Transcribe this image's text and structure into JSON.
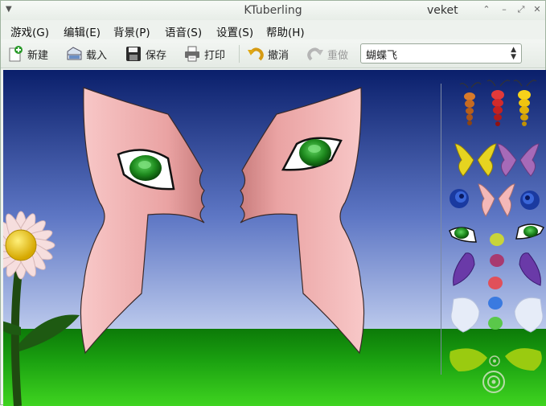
{
  "window": {
    "title": "KTuberling",
    "user": "veket",
    "buttons": {
      "minimize": "⌃",
      "maximize": "–",
      "restore": "⤢",
      "close": "✕"
    }
  },
  "menu": [
    {
      "label": "游戏(G)"
    },
    {
      "label": "编辑(E)"
    },
    {
      "label": "背景(P)"
    },
    {
      "label": "语音(S)"
    },
    {
      "label": "设置(S)"
    },
    {
      "label": "帮助(H)"
    }
  ],
  "toolbar": {
    "new_label": "新建",
    "load_label": "载入",
    "save_label": "保存",
    "print_label": "打印",
    "undo_label": "撤消",
    "redo_label": "重做"
  },
  "playground_select": {
    "value": "蝴蝶飞"
  },
  "colors": {
    "sky_top": "#0a1f6b",
    "sky_bottom": "#b8c6ee",
    "grass": "#1a9a10",
    "wing": "#f7c2c2",
    "eye": "#1e8a1e"
  }
}
